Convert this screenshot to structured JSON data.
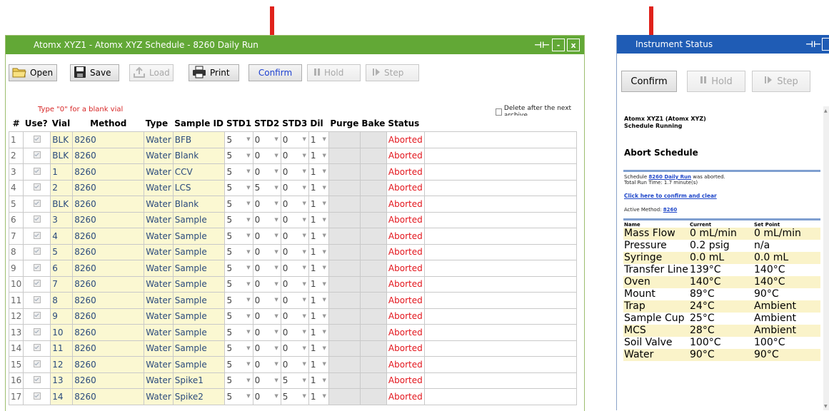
{
  "schedule_window": {
    "title": "Atomx XYZ1 - Atomx XYZ  Schedule -  8260 Daily Run",
    "pin": "⊣⊢",
    "minimize": "-",
    "close": "x",
    "toolbar": {
      "open": "Open",
      "save": "Save",
      "load": "Load",
      "print": "Print",
      "confirm": "Confirm",
      "hold": "Hold",
      "step": "Step"
    },
    "blank_note": "Type \"0\" for a blank vial",
    "delete_after_archive": "Delete after the next archive",
    "columns": [
      "#",
      "Use?",
      "Vial",
      "Method",
      "Type",
      "Sample ID",
      "STD1",
      "STD2",
      "STD3",
      "Dil",
      "Purge",
      "Bake",
      "Status"
    ],
    "rows": [
      {
        "num": "1",
        "vial": "BLK",
        "method": "8260",
        "type": "Water",
        "sample_id": "BFB",
        "std1": "5",
        "std2": "0",
        "std3": "0",
        "dil": "1",
        "status": "Aborted"
      },
      {
        "num": "2",
        "vial": "BLK",
        "method": "8260",
        "type": "Water",
        "sample_id": "Blank",
        "std1": "5",
        "std2": "0",
        "std3": "0",
        "dil": "1",
        "status": "Aborted"
      },
      {
        "num": "3",
        "vial": "1",
        "method": "8260",
        "type": "Water",
        "sample_id": "CCV",
        "std1": "5",
        "std2": "0",
        "std3": "0",
        "dil": "1",
        "status": "Aborted"
      },
      {
        "num": "4",
        "vial": "2",
        "method": "8260",
        "type": "Water",
        "sample_id": "LCS",
        "std1": "5",
        "std2": "5",
        "std3": "0",
        "dil": "1",
        "status": "Aborted"
      },
      {
        "num": "5",
        "vial": "BLK",
        "method": "8260",
        "type": "Water",
        "sample_id": "Blank",
        "std1": "5",
        "std2": "0",
        "std3": "0",
        "dil": "1",
        "status": "Aborted"
      },
      {
        "num": "6",
        "vial": "3",
        "method": "8260",
        "type": "Water",
        "sample_id": "Sample",
        "std1": "5",
        "std2": "0",
        "std3": "0",
        "dil": "1",
        "status": "Aborted"
      },
      {
        "num": "7",
        "vial": "4",
        "method": "8260",
        "type": "Water",
        "sample_id": "Sample",
        "std1": "5",
        "std2": "0",
        "std3": "0",
        "dil": "1",
        "status": "Aborted"
      },
      {
        "num": "8",
        "vial": "5",
        "method": "8260",
        "type": "Water",
        "sample_id": "Sample",
        "std1": "5",
        "std2": "0",
        "std3": "0",
        "dil": "1",
        "status": "Aborted"
      },
      {
        "num": "9",
        "vial": "6",
        "method": "8260",
        "type": "Water",
        "sample_id": "Sample",
        "std1": "5",
        "std2": "0",
        "std3": "0",
        "dil": "1",
        "status": "Aborted"
      },
      {
        "num": "10",
        "vial": "7",
        "method": "8260",
        "type": "Water",
        "sample_id": "Sample",
        "std1": "5",
        "std2": "0",
        "std3": "0",
        "dil": "1",
        "status": "Aborted"
      },
      {
        "num": "11",
        "vial": "8",
        "method": "8260",
        "type": "Water",
        "sample_id": "Sample",
        "std1": "5",
        "std2": "0",
        "std3": "0",
        "dil": "1",
        "status": "Aborted"
      },
      {
        "num": "12",
        "vial": "9",
        "method": "8260",
        "type": "Water",
        "sample_id": "Sample",
        "std1": "5",
        "std2": "0",
        "std3": "0",
        "dil": "1",
        "status": "Aborted"
      },
      {
        "num": "13",
        "vial": "10",
        "method": "8260",
        "type": "Water",
        "sample_id": "Sample",
        "std1": "5",
        "std2": "0",
        "std3": "0",
        "dil": "1",
        "status": "Aborted"
      },
      {
        "num": "14",
        "vial": "11",
        "method": "8260",
        "type": "Water",
        "sample_id": "Sample",
        "std1": "5",
        "std2": "0",
        "std3": "0",
        "dil": "1",
        "status": "Aborted"
      },
      {
        "num": "15",
        "vial": "12",
        "method": "8260",
        "type": "Water",
        "sample_id": "Sample",
        "std1": "5",
        "std2": "0",
        "std3": "0",
        "dil": "1",
        "status": "Aborted"
      },
      {
        "num": "16",
        "vial": "13",
        "method": "8260",
        "type": "Water",
        "sample_id": "Spike1",
        "std1": "5",
        "std2": "0",
        "std3": "5",
        "dil": "1",
        "status": "Aborted"
      },
      {
        "num": "17",
        "vial": "14",
        "method": "8260",
        "type": "Water",
        "sample_id": "Spike2",
        "std1": "5",
        "std2": "0",
        "std3": "5",
        "dil": "1",
        "status": "Aborted"
      }
    ]
  },
  "status_window": {
    "title": "Instrument Status",
    "pin": "⊣⊢",
    "buttons": {
      "confirm": "Confirm",
      "hold": "Hold",
      "step": "Step"
    },
    "header_line1": "Atomx XYZ1 (Atomx XYZ)",
    "header_line2": "Schedule Running",
    "abort_title": "Abort Schedule",
    "schedule_prefix": "Schedule ",
    "schedule_link": "8260 Daily Run",
    "schedule_suffix": " was aborted.",
    "run_time": "Total Run Time: 1.7 minute(s)",
    "confirm_link": "Click here to confirm and clear",
    "active_method_label": "Active Method: ",
    "active_method_link": "8260",
    "table_headers": {
      "name": "Name",
      "current": "Current",
      "set_point": "Set Point"
    },
    "readings": [
      {
        "name": "Mass Flow",
        "current": "0 mL/min",
        "set": "0 mL/min"
      },
      {
        "name": "Pressure",
        "current": "0.2 psig",
        "set": "n/a"
      },
      {
        "name": "Syringe",
        "current": "0.0 mL",
        "set": "0.0 mL"
      },
      {
        "name": "Transfer Line",
        "current": "139°C",
        "set": "140°C"
      },
      {
        "name": "Oven",
        "current": "140°C",
        "set": "140°C"
      },
      {
        "name": "Mount",
        "current": "89°C",
        "set": "90°C"
      },
      {
        "name": "Trap",
        "current": "24°C",
        "set": "Ambient"
      },
      {
        "name": "Sample Cup",
        "current": "25°C",
        "set": "Ambient"
      },
      {
        "name": "MCS",
        "current": "28°C",
        "set": "Ambient"
      },
      {
        "name": "Soil Valve",
        "current": "100°C",
        "set": "100°C"
      },
      {
        "name": "Water",
        "current": "90°C",
        "set": "90°C"
      }
    ]
  },
  "colors": {
    "schedule_title_bar": "#62a836",
    "status_title_bar": "#1f5cb5",
    "aborted": "#e3141b",
    "annotation_arrow": "#e0221b",
    "editable_cell": "#fbf8d2"
  }
}
